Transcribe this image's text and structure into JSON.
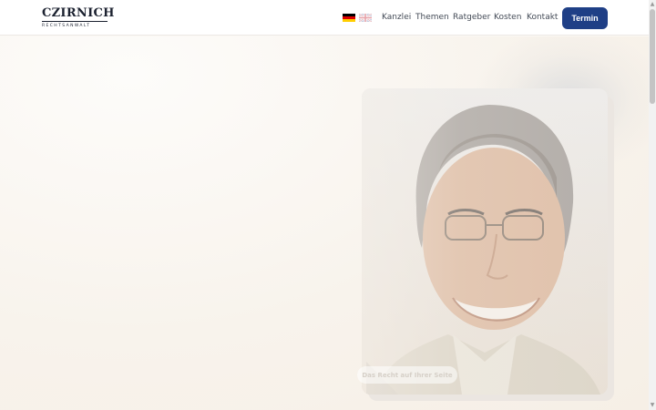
{
  "brand": {
    "name": "CZIRNICH",
    "subtitle": "RECHTSANWALT"
  },
  "languages": [
    {
      "code": "de",
      "icon": "flag-de-icon"
    },
    {
      "code": "en",
      "icon": "flag-gb-icon"
    }
  ],
  "nav": {
    "items": [
      {
        "label": "Kanzlei"
      },
      {
        "label": "Themen"
      },
      {
        "label": "Ratgeber"
      },
      {
        "label": "Kosten"
      },
      {
        "label": "Kontakt"
      }
    ],
    "cta_label": "Termin"
  },
  "hero": {
    "tagline": "Das Recht auf Ihrer Seite"
  },
  "colors": {
    "accent": "#1f3f86",
    "background": "#fbf8f4",
    "text": "#444b57"
  }
}
